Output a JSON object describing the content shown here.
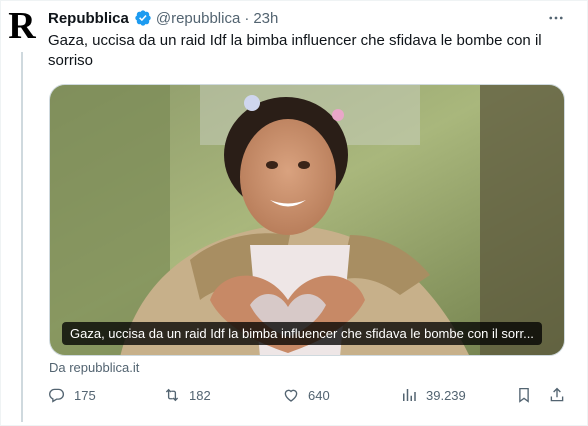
{
  "author": {
    "name": "Repubblica",
    "handle": "@repubblica",
    "time": "23h",
    "avatar_letter": "R"
  },
  "separator": "·",
  "tweet": {
    "text": "Gaza, uccisa da un raid Idf la bimba influencer che sfidava le bombe con il sorriso"
  },
  "media": {
    "caption": "Gaza, uccisa da un raid Idf la bimba influencer che sfidava le bombe con il sorr..."
  },
  "link_source": "Da repubblica.it",
  "actions": {
    "replies": "175",
    "reposts": "182",
    "likes": "640",
    "views": "39.239"
  },
  "icons": [
    "verified-badge-icon",
    "more-icon",
    "reply-icon",
    "repost-icon",
    "like-icon",
    "views-icon",
    "bookmark-icon",
    "share-icon"
  ],
  "colors": {
    "verified": "#1d9bf0",
    "muted": "#536471",
    "text": "#0f1419"
  }
}
